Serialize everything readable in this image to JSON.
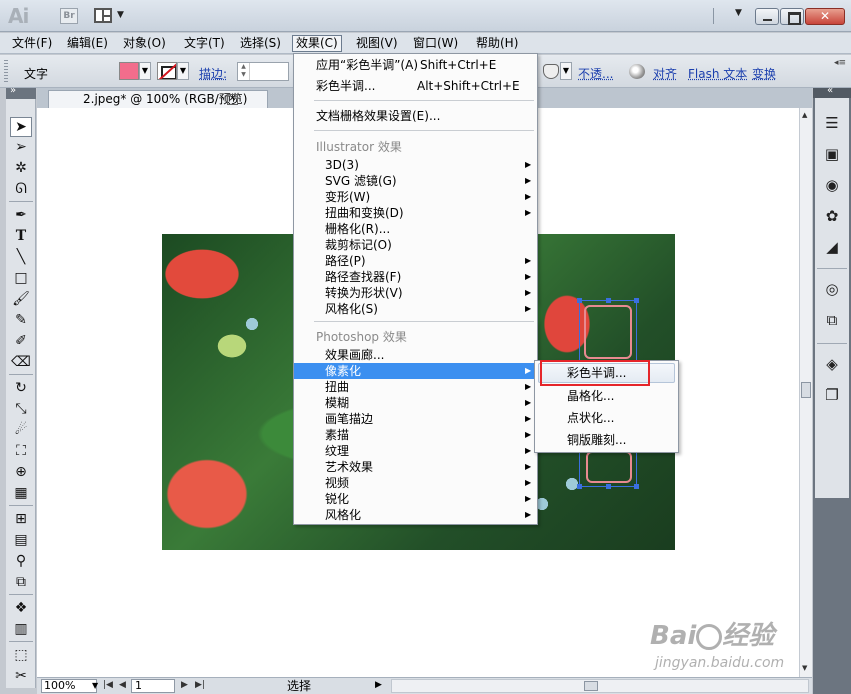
{
  "app": {
    "logo": "Ai",
    "bridge": "Br"
  },
  "menubar": [
    {
      "label": "文件(F)"
    },
    {
      "label": "编辑(E)"
    },
    {
      "label": "对象(O)"
    },
    {
      "label": "文字(T)"
    },
    {
      "label": "选择(S)"
    },
    {
      "label": "效果(C)"
    },
    {
      "label": "视图(V)"
    },
    {
      "label": "窗口(W)"
    },
    {
      "label": "帮助(H)"
    }
  ],
  "control": {
    "tool_label": "文字",
    "stroke_label": "描边:",
    "opacity_label": "不透...",
    "align_label": "对齐",
    "flash_label": "Flash 文本",
    "transform_label": "变换",
    "fill_color": "#f26d8c"
  },
  "document": {
    "tab_title": "2.jpeg* @ 100% (RGB/预览)"
  },
  "effect_menu": {
    "apply_last": {
      "label": "应用“彩色半调”(A)",
      "shortcut": "Shift+Ctrl+E"
    },
    "last": {
      "label": "彩色半调...",
      "shortcut": "Alt+Shift+Ctrl+E"
    },
    "raster_settings": "文档栅格效果设置(E)...",
    "illustrator_header": "Illustrator 效果",
    "illustrator_items": [
      "3D(3)",
      "SVG 滤镜(G)",
      "变形(W)",
      "扭曲和变换(D)",
      "栅格化(R)...",
      "裁剪标记(O)",
      "路径(P)",
      "路径查找器(F)",
      "转换为形状(V)",
      "风格化(S)"
    ],
    "photoshop_header": "Photoshop 效果",
    "photoshop_items": [
      "效果画廊...",
      "像素化",
      "扭曲",
      "模糊",
      "画笔描边",
      "素描",
      "纹理",
      "艺术效果",
      "视频",
      "锐化",
      "风格化"
    ]
  },
  "pixelate_submenu": [
    "彩色半调...",
    "晶格化...",
    "点状化...",
    "铜版雕刻..."
  ],
  "status": {
    "zoom": "100%",
    "page": "1",
    "mode": "选择"
  },
  "watermark": {
    "brand": "Bai",
    "brand_suffix": "经验",
    "url": "jingyan.baidu.com"
  },
  "colors": {
    "highlight": "#3b8ff0",
    "annotation": "#e5252a"
  }
}
